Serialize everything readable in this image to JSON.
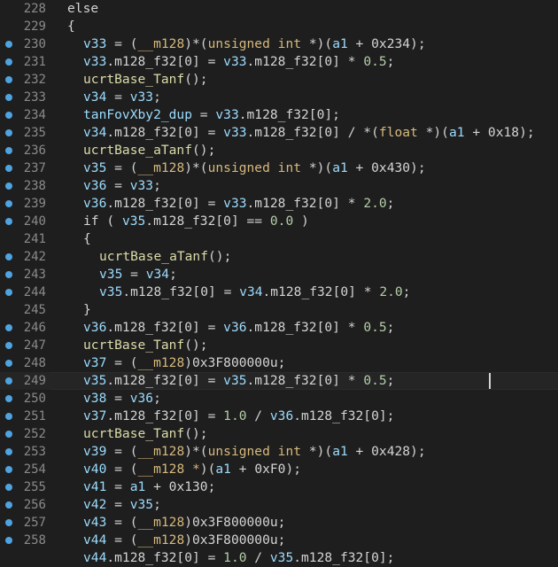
{
  "editor": {
    "current_line": 249,
    "breakpoint_color": "#4ea3e0",
    "lines": [
      {
        "num": 228,
        "bp": false,
        "indent": 0,
        "tokens": [
          [
            "k",
            "else"
          ]
        ]
      },
      {
        "num": 229,
        "bp": false,
        "indent": 0,
        "tokens": [
          [
            "p",
            "{"
          ]
        ]
      },
      {
        "num": 230,
        "bp": true,
        "indent": 1,
        "tokens": [
          [
            "v",
            "v33"
          ],
          [
            "p",
            " = ("
          ],
          [
            "t",
            "__m128"
          ],
          [
            "p",
            ")*("
          ],
          [
            "t",
            "unsigned int"
          ],
          [
            "p",
            " *)("
          ],
          [
            "v",
            "a1"
          ],
          [
            "p",
            " + 0x234);"
          ]
        ]
      },
      {
        "num": 231,
        "bp": true,
        "indent": 1,
        "tokens": [
          [
            "v",
            "v33"
          ],
          [
            "p",
            ".m128_f32[0] = "
          ],
          [
            "v",
            "v33"
          ],
          [
            "p",
            ".m128_f32[0] * "
          ],
          [
            "n",
            "0.5"
          ],
          [
            "p",
            ";"
          ]
        ]
      },
      {
        "num": 232,
        "bp": true,
        "indent": 1,
        "tokens": [
          [
            "f",
            "ucrtBase_Tanf"
          ],
          [
            "p",
            "();"
          ]
        ]
      },
      {
        "num": 233,
        "bp": true,
        "indent": 1,
        "tokens": [
          [
            "v",
            "v34"
          ],
          [
            "p",
            " = "
          ],
          [
            "v",
            "v33"
          ],
          [
            "p",
            ";"
          ]
        ]
      },
      {
        "num": 234,
        "bp": true,
        "indent": 1,
        "tokens": [
          [
            "v",
            "tanFovXby2_dup"
          ],
          [
            "p",
            " = "
          ],
          [
            "v",
            "v33"
          ],
          [
            "p",
            ".m128_f32[0];"
          ]
        ]
      },
      {
        "num": 235,
        "bp": true,
        "indent": 1,
        "tokens": [
          [
            "v",
            "v34"
          ],
          [
            "p",
            ".m128_f32[0] = "
          ],
          [
            "v",
            "v33"
          ],
          [
            "p",
            ".m128_f32[0] / *("
          ],
          [
            "t",
            "float"
          ],
          [
            "p",
            " *)("
          ],
          [
            "v",
            "a1"
          ],
          [
            "p",
            " + 0x18);"
          ]
        ]
      },
      {
        "num": 236,
        "bp": true,
        "indent": 1,
        "tokens": [
          [
            "f",
            "ucrtBase_aTanf"
          ],
          [
            "p",
            "();"
          ]
        ]
      },
      {
        "num": 237,
        "bp": true,
        "indent": 1,
        "tokens": [
          [
            "v",
            "v35"
          ],
          [
            "p",
            " = ("
          ],
          [
            "t",
            "__m128"
          ],
          [
            "p",
            ")*("
          ],
          [
            "t",
            "unsigned int"
          ],
          [
            "p",
            " *)("
          ],
          [
            "v",
            "a1"
          ],
          [
            "p",
            " + 0x430);"
          ]
        ]
      },
      {
        "num": 238,
        "bp": true,
        "indent": 1,
        "tokens": [
          [
            "v",
            "v36"
          ],
          [
            "p",
            " = "
          ],
          [
            "v",
            "v33"
          ],
          [
            "p",
            ";"
          ]
        ]
      },
      {
        "num": 239,
        "bp": true,
        "indent": 1,
        "tokens": [
          [
            "v",
            "v36"
          ],
          [
            "p",
            ".m128_f32[0] = "
          ],
          [
            "v",
            "v33"
          ],
          [
            "p",
            ".m128_f32[0] * "
          ],
          [
            "n",
            "2.0"
          ],
          [
            "p",
            ";"
          ]
        ]
      },
      {
        "num": 240,
        "bp": true,
        "indent": 1,
        "tokens": [
          [
            "k",
            "if"
          ],
          [
            "p",
            " ( "
          ],
          [
            "v",
            "v35"
          ],
          [
            "p",
            ".m128_f32[0] == "
          ],
          [
            "n",
            "0.0"
          ],
          [
            "p",
            " )"
          ]
        ]
      },
      {
        "num": 241,
        "bp": false,
        "indent": 1,
        "tokens": [
          [
            "p",
            "{"
          ]
        ]
      },
      {
        "num": 242,
        "bp": true,
        "indent": 2,
        "tokens": [
          [
            "f",
            "ucrtBase_aTanf"
          ],
          [
            "p",
            "();"
          ]
        ]
      },
      {
        "num": 243,
        "bp": true,
        "indent": 2,
        "tokens": [
          [
            "v",
            "v35"
          ],
          [
            "p",
            " = "
          ],
          [
            "v",
            "v34"
          ],
          [
            "p",
            ";"
          ]
        ]
      },
      {
        "num": 244,
        "bp": true,
        "indent": 2,
        "tokens": [
          [
            "v",
            "v35"
          ],
          [
            "p",
            ".m128_f32[0] = "
          ],
          [
            "v",
            "v34"
          ],
          [
            "p",
            ".m128_f32[0] * "
          ],
          [
            "n",
            "2.0"
          ],
          [
            "p",
            ";"
          ]
        ]
      },
      {
        "num": 245,
        "bp": false,
        "indent": 1,
        "tokens": [
          [
            "p",
            "}"
          ]
        ]
      },
      {
        "num": 246,
        "bp": true,
        "indent": 1,
        "tokens": [
          [
            "v",
            "v36"
          ],
          [
            "p",
            ".m128_f32[0] = "
          ],
          [
            "v",
            "v36"
          ],
          [
            "p",
            ".m128_f32[0] * "
          ],
          [
            "n",
            "0.5"
          ],
          [
            "p",
            ";"
          ]
        ]
      },
      {
        "num": 247,
        "bp": true,
        "indent": 1,
        "tokens": [
          [
            "f",
            "ucrtBase_Tanf"
          ],
          [
            "p",
            "();"
          ]
        ]
      },
      {
        "num": 248,
        "bp": true,
        "indent": 1,
        "tokens": [
          [
            "v",
            "v37"
          ],
          [
            "p",
            " = ("
          ],
          [
            "t",
            "__m128"
          ],
          [
            "p",
            ")0x3F800000u;"
          ]
        ]
      },
      {
        "num": 249,
        "bp": true,
        "indent": 1,
        "tokens": [
          [
            "v",
            "v35"
          ],
          [
            "p",
            ".m128_f32[0] = "
          ],
          [
            "v",
            "v35"
          ],
          [
            "p",
            ".m128_f32[0] * "
          ],
          [
            "n",
            "0.5"
          ],
          [
            "p",
            ";"
          ]
        ]
      },
      {
        "num": 250,
        "bp": true,
        "indent": 1,
        "tokens": [
          [
            "v",
            "v38"
          ],
          [
            "p",
            " = "
          ],
          [
            "v",
            "v36"
          ],
          [
            "p",
            ";"
          ]
        ]
      },
      {
        "num": 251,
        "bp": true,
        "indent": 1,
        "tokens": [
          [
            "v",
            "v37"
          ],
          [
            "p",
            ".m128_f32[0] = "
          ],
          [
            "n",
            "1.0"
          ],
          [
            "p",
            " / "
          ],
          [
            "v",
            "v36"
          ],
          [
            "p",
            ".m128_f32[0];"
          ]
        ]
      },
      {
        "num": 252,
        "bp": true,
        "indent": 1,
        "tokens": [
          [
            "f",
            "ucrtBase_Tanf"
          ],
          [
            "p",
            "();"
          ]
        ]
      },
      {
        "num": 253,
        "bp": true,
        "indent": 1,
        "tokens": [
          [
            "v",
            "v39"
          ],
          [
            "p",
            " = ("
          ],
          [
            "t",
            "__m128"
          ],
          [
            "p",
            ")*("
          ],
          [
            "t",
            "unsigned int"
          ],
          [
            "p",
            " *)("
          ],
          [
            "v",
            "a1"
          ],
          [
            "p",
            " + 0x428);"
          ]
        ]
      },
      {
        "num": 254,
        "bp": true,
        "indent": 1,
        "tokens": [
          [
            "v",
            "v40"
          ],
          [
            "p",
            " = ("
          ],
          [
            "t",
            "__m128 *"
          ],
          [
            "p",
            ")("
          ],
          [
            "v",
            "a1"
          ],
          [
            "p",
            " + 0xF0);"
          ]
        ]
      },
      {
        "num": 255,
        "bp": true,
        "indent": 1,
        "tokens": [
          [
            "v",
            "v41"
          ],
          [
            "p",
            " = "
          ],
          [
            "v",
            "a1"
          ],
          [
            "p",
            " + 0x130;"
          ]
        ]
      },
      {
        "num": 256,
        "bp": true,
        "indent": 1,
        "tokens": [
          [
            "v",
            "v42"
          ],
          [
            "p",
            " = "
          ],
          [
            "v",
            "v35"
          ],
          [
            "p",
            ";"
          ]
        ]
      },
      {
        "num": 257,
        "bp": true,
        "indent": 1,
        "tokens": [
          [
            "v",
            "v43"
          ],
          [
            "p",
            " = ("
          ],
          [
            "t",
            "__m128"
          ],
          [
            "p",
            ")0x3F800000u;"
          ]
        ]
      },
      {
        "num": 258,
        "bp": true,
        "indent": 1,
        "tokens": [
          [
            "v",
            "v44"
          ],
          [
            "p",
            " = ("
          ],
          [
            "t",
            "__m128"
          ],
          [
            "p",
            ")0x3F800000u;"
          ]
        ]
      },
      {
        "num": "",
        "bp": false,
        "indent": 1,
        "tokens": [
          [
            "v",
            "v44"
          ],
          [
            "p",
            ".m128_f32[0] = "
          ],
          [
            "n",
            "1.0"
          ],
          [
            "p",
            " / "
          ],
          [
            "v",
            "v35"
          ],
          [
            "p",
            ".m128_f32[0];"
          ]
        ]
      }
    ]
  }
}
